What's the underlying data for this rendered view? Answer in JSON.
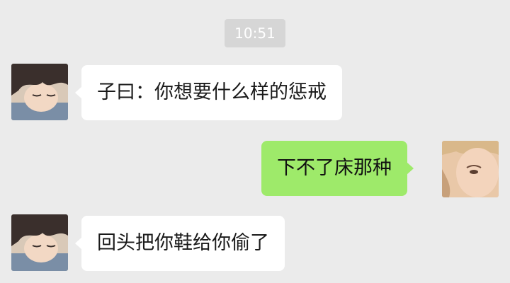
{
  "chat": {
    "timestamp": "10:51",
    "messages": [
      {
        "side": "left",
        "text": "子曰：你想要什么样的惩戒",
        "avatar": "anime-boy-avatar"
      },
      {
        "side": "right",
        "text": "下不了床那种",
        "avatar": "girl-photo-avatar"
      },
      {
        "side": "left",
        "text": "回头把你鞋给你偷了",
        "avatar": "anime-boy-avatar"
      }
    ]
  },
  "colors": {
    "background": "#ebebeb",
    "left_bubble": "#ffffff",
    "right_bubble": "#9eea6a",
    "timestamp_bg": "#d6d6d6"
  }
}
